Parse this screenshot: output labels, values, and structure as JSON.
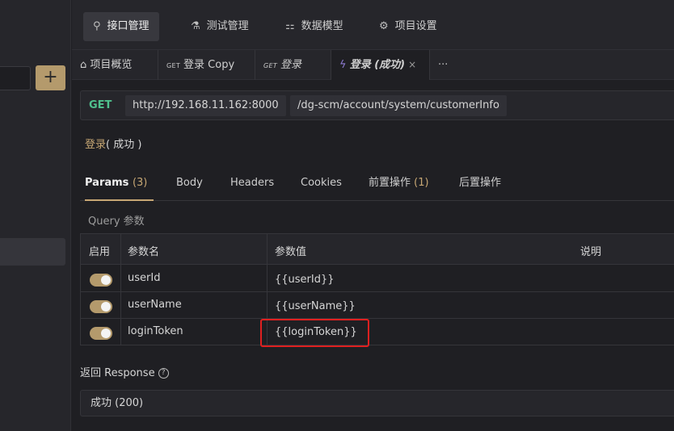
{
  "sidebar": {
    "add_label": "+"
  },
  "topnav": {
    "items": [
      {
        "icon": "link-icon",
        "glyph": "⚲",
        "label": "接口管理"
      },
      {
        "icon": "flask-icon",
        "glyph": "⚗",
        "label": "测试管理"
      },
      {
        "icon": "sitemap-icon",
        "glyph": "⚏",
        "label": "数据模型"
      },
      {
        "icon": "gear-icon",
        "glyph": "⚙",
        "label": "项目设置"
      }
    ]
  },
  "tabs": [
    {
      "icon_glyph": "⌂",
      "label": "项目概览"
    },
    {
      "method": "GET",
      "label": "登录 Copy"
    },
    {
      "method": "GET",
      "label": "登录"
    },
    {
      "icon_glyph": "ϟ",
      "label": "登录 (成功)",
      "close": "×"
    },
    {
      "more": "···"
    }
  ],
  "request": {
    "method": "GET",
    "host": "http://192.168.11.162:8000",
    "path": "/dg-scm/account/system/customerInfo",
    "name": "登录",
    "name_status": "( 成功 )"
  },
  "request_tabs": [
    {
      "label": "Params",
      "count": "(3)"
    },
    {
      "label": "Body"
    },
    {
      "label": "Headers"
    },
    {
      "label": "Cookies"
    },
    {
      "label": "前置操作",
      "count": "(1)"
    },
    {
      "label": "后置操作"
    }
  ],
  "query_label": "Query 参数",
  "params_table": {
    "headers": [
      "启用",
      "参数名",
      "参数值",
      "说明"
    ],
    "rows": [
      {
        "enabled": true,
        "name": "userId",
        "value": "{{userId}}"
      },
      {
        "enabled": true,
        "name": "userName",
        "value": "{{userName}}"
      },
      {
        "enabled": true,
        "name": "loginToken",
        "value": "{{loginToken}}"
      }
    ]
  },
  "response": {
    "label": "返回 Response",
    "help": "?",
    "status": "成功 (200)"
  },
  "colors": {
    "accent": "#b49a6c",
    "method_get": "#4fc08d",
    "highlight": "#e02020"
  }
}
